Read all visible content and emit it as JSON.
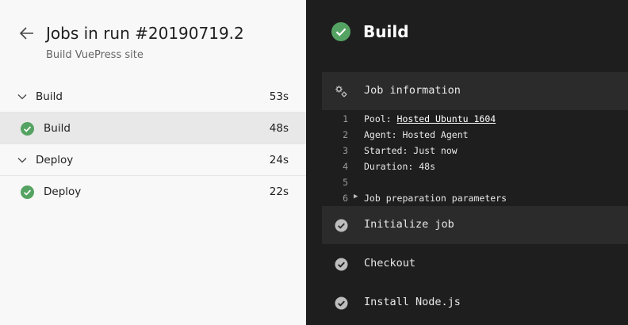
{
  "header": {
    "title": "Jobs in run #20190719.2",
    "subtitle": "Build VuePress site"
  },
  "jobs": {
    "groups": [
      {
        "label": "Build",
        "duration": "53s",
        "job": {
          "label": "Build",
          "duration": "48s"
        }
      },
      {
        "label": "Deploy",
        "duration": "24s",
        "job": {
          "label": "Deploy",
          "duration": "22s"
        }
      }
    ]
  },
  "detail": {
    "title": "Build",
    "steps": [
      {
        "label": "Job information"
      },
      {
        "label": "Initialize job"
      },
      {
        "label": "Checkout"
      },
      {
        "label": "Install Node.js"
      }
    ],
    "log": [
      {
        "num": "1",
        "prefix": "Pool: ",
        "link": "Hosted Ubuntu 1604"
      },
      {
        "num": "2",
        "text": "Agent: Hosted Agent"
      },
      {
        "num": "3",
        "text": "Started: Just now"
      },
      {
        "num": "4",
        "text": "Duration: 48s"
      },
      {
        "num": "5",
        "text": ""
      },
      {
        "num": "6",
        "text": "Job preparation parameters"
      }
    ]
  },
  "colors": {
    "success": "#55a362",
    "step_check": "#bdbdbd",
    "dark_bg": "#1e1e1e",
    "light_bg": "#f8f8f8"
  }
}
